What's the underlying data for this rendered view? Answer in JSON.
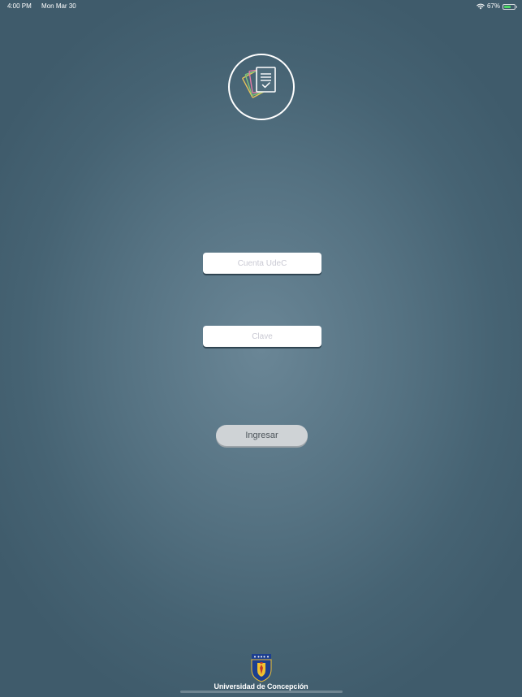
{
  "status_bar": {
    "time": "4:00 PM",
    "date": "Mon Mar 30",
    "battery_percent": "67%",
    "battery_level": 0.67,
    "battery_color": "#4cd964"
  },
  "logo": {
    "icon": "document-stack-icon"
  },
  "login_form": {
    "username_placeholder": "Cuenta UdeC",
    "username_value": "",
    "password_placeholder": "Clave",
    "password_value": "",
    "submit_label": "Ingresar"
  },
  "footer": {
    "crest_icon": "university-crest-icon",
    "university_name": "Universidad de Concepción"
  },
  "colors": {
    "background_center": "#6a8696",
    "background_edge": "#3f5b6b",
    "button_bg": "#cfd3d6",
    "button_text": "#4b5359"
  }
}
